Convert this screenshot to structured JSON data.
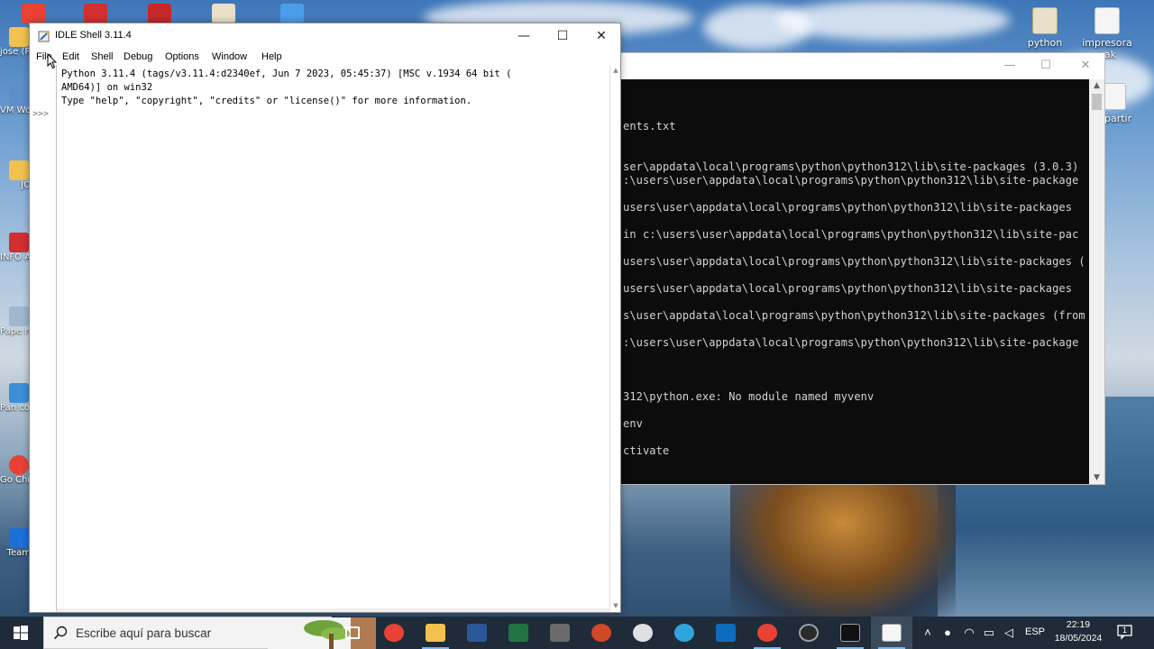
{
  "desktop": {
    "right_icons": [
      {
        "label": "python",
        "icon": "python-file-icon"
      },
      {
        "label": "impresora pak",
        "icon": "document-icon"
      },
      {
        "label": "partir",
        "icon": "document-icon"
      }
    ],
    "left_icons": [
      {
        "label": "jose (Pers",
        "icon": "user-folder-icon"
      },
      {
        "label": "VM Work",
        "icon": "vmware-icon"
      },
      {
        "label": "JO",
        "icon": "folder-icon"
      },
      {
        "label": "INFO ABR",
        "icon": "pdf-icon"
      },
      {
        "label": "Pape reci",
        "icon": "recycle-bin-icon"
      },
      {
        "label": "Pan con",
        "icon": "control-panel-icon"
      },
      {
        "label": "Go Chr",
        "icon": "chrome-icon"
      },
      {
        "label": "Team",
        "icon": "teamviewer-icon"
      }
    ]
  },
  "console": {
    "lines": [
      "ents.txt",
      "ser\\appdata\\local\\programs\\python\\python312\\lib\\site-packages (3.0.3)",
      ":\\users\\user\\appdata\\local\\programs\\python\\python312\\lib\\site-package",
      "users\\user\\appdata\\local\\programs\\python\\python312\\lib\\site-packages",
      " in c:\\users\\user\\appdata\\local\\programs\\python\\python312\\lib\\site-pac",
      "users\\user\\appdata\\local\\programs\\python\\python312\\lib\\site-packages (",
      " users\\user\\appdata\\local\\programs\\python\\python312\\lib\\site-packages",
      "s\\user\\appdata\\local\\programs\\python\\python312\\lib\\site-packages (from",
      ":\\users\\user\\appdata\\local\\programs\\python\\python312\\lib\\site-package",
      "312\\python.exe: No module named myvenv",
      "env",
      "ctivate"
    ]
  },
  "idle": {
    "title": "IDLE Shell 3.11.4",
    "minimize": "—",
    "maximize": "☐",
    "close": "✕",
    "menu": [
      "File",
      "Edit",
      "Shell",
      "Debug",
      "Options",
      "Window",
      "Help"
    ],
    "prompt": ">>>",
    "banner": [
      "Python 3.11.4 (tags/v3.11.4:d2340ef, Jun  7 2023, 05:45:37) [MSC v.1934 64 bit (",
      "AMD64)] on win32",
      "Type \"help\", \"copyright\", \"credits\" or \"license()\" for more information."
    ]
  },
  "taskbar": {
    "search_placeholder": "Escribe aquí para buscar",
    "apps": [
      {
        "name": "task-view-icon",
        "color": "#ffffff"
      },
      {
        "name": "chrome-icon",
        "color": "#e94235"
      },
      {
        "name": "file-explorer-icon",
        "color": "#f2c14e"
      },
      {
        "name": "word-icon",
        "color": "#2b579a"
      },
      {
        "name": "excel-icon",
        "color": "#217346"
      },
      {
        "name": "calculator-icon",
        "color": "#6b6b6b"
      },
      {
        "name": "powerpoint-icon",
        "color": "#d24726"
      },
      {
        "name": "paint-icon",
        "color": "#e0e0e0"
      },
      {
        "name": "edge-icon",
        "color": "#2fa5e0"
      },
      {
        "name": "outlook-icon",
        "color": "#0f6cbd"
      },
      {
        "name": "chrome-icon",
        "color": "#e94235"
      },
      {
        "name": "obs-icon",
        "color": "#9aa0a6"
      },
      {
        "name": "terminal-icon",
        "color": "#222222"
      },
      {
        "name": "idle-icon",
        "color": "#f5d76e"
      }
    ],
    "language": "ESP",
    "time": "22:19",
    "date": "18/05/2024",
    "notification_count": "1"
  }
}
